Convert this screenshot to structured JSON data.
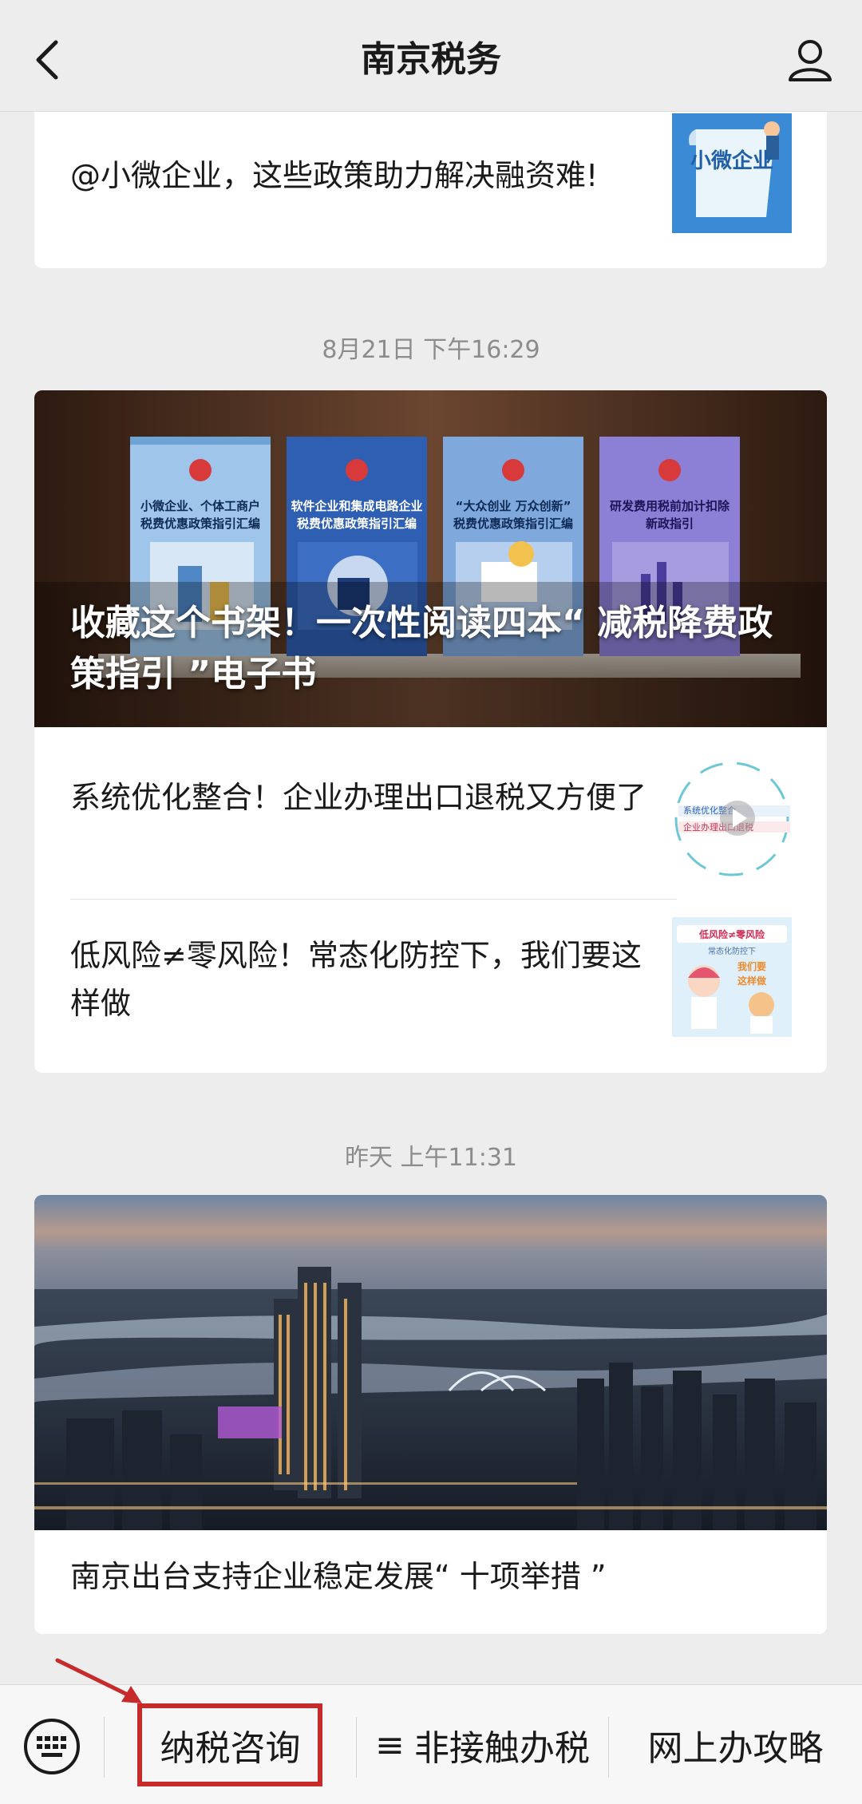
{
  "header": {
    "title": "南京税务",
    "back_icon": "chevron-left-icon",
    "profile_icon": "person-icon"
  },
  "feed": {
    "card1": {
      "text": "@小微企业，这些政策助力解决融资难!",
      "thumb_text": "小微企业"
    },
    "group2": {
      "timestamp": "8月21日 下午16:29",
      "cover_title": "收藏这个书架！一次性阅读四本“ 减税降费政策指引 ”电子书",
      "books": [
        "小微企业、个体工商户税费优惠政策指引汇编",
        "软件企业和集成电路企业税费优惠政策指引汇编",
        "“大众创业 万众创新”税费优惠政策指引汇编",
        "研发费用税前加计扣除新政指引"
      ],
      "items": [
        {
          "text": "系统优化整合！企业办理出口退税又方便了",
          "thumb_text": "系统优化整合 企业办理出口退税又方便了"
        },
        {
          "text": "低风险≠零风险！常态化防控下，我们要这样做",
          "thumb_text": "低风险≠零风险 常态化防控下 我们要这样做"
        }
      ]
    },
    "group3": {
      "timestamp": "昨天 上午11:31",
      "title": "南京出台支持企业稳定发展“ 十项举措 ”"
    }
  },
  "bottom_menu": {
    "keyboard_icon": "keyboard-icon",
    "items": [
      "纳税咨询",
      "非接触办税",
      "网上办攻略"
    ],
    "menu_glyph": "≡",
    "highlight_color": "#c62a2a"
  }
}
